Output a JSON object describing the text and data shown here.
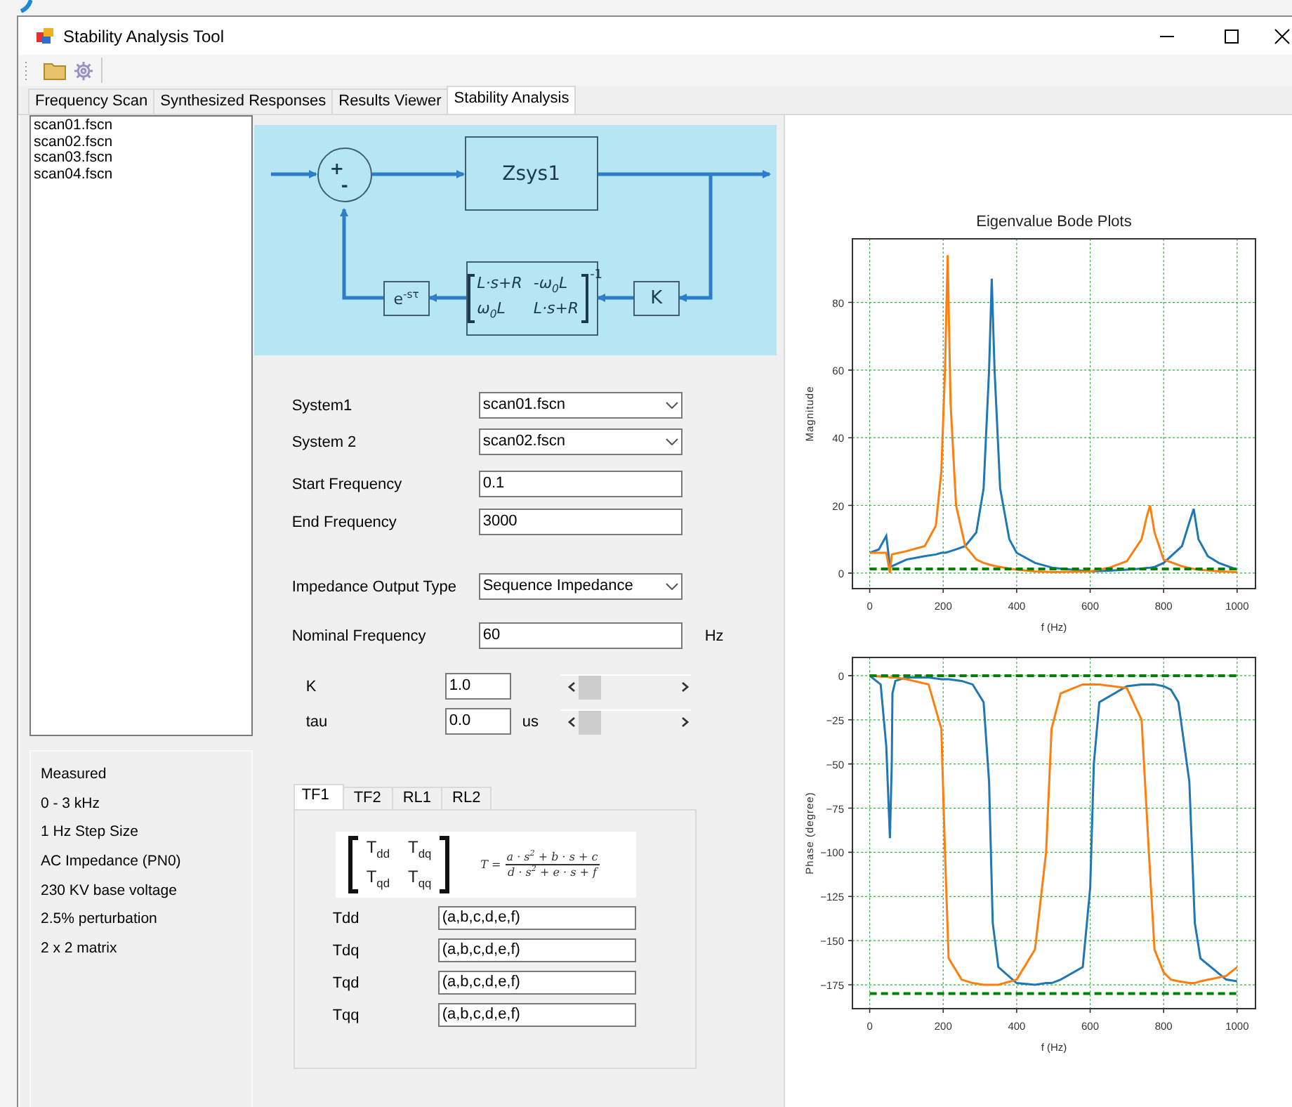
{
  "window": {
    "title": "Stability Analysis Tool"
  },
  "tabs": [
    {
      "label": "Frequency Scan",
      "selected": false
    },
    {
      "label": "Synthesized Responses",
      "selected": false
    },
    {
      "label": "Results Viewer",
      "selected": false
    },
    {
      "label": "Stability Analysis",
      "selected": true
    }
  ],
  "files": [
    "scan01.fscn",
    "scan02.fscn",
    "scan03.fscn",
    "scan04.fscn"
  ],
  "info": [
    "Measured",
    "0 - 3 kHz",
    "1 Hz Step Size",
    "AC Impedance (PN0)",
    "230 KV base voltage",
    "2.5% perturbation",
    "2 x 2 matrix"
  ],
  "diagram": {
    "input_sign": "+",
    "feedback_sign": "-",
    "plant": "Zsys1",
    "delay": "e$^{-sτ}$",
    "matrix": [
      "L·s+R",
      "-ω$_{0}$L",
      "ω$_{0}$L",
      "L·s+R"
    ],
    "matrix_power": "-1",
    "gain": "K"
  },
  "form": [
    {
      "kind": "dropdown",
      "label": "System1",
      "value": "scan01.fscn"
    },
    {
      "kind": "dropdown",
      "label": "System 2",
      "value": "scan02.fscn"
    },
    {
      "kind": "text",
      "label": "Start Frequency",
      "value": "0.1"
    },
    {
      "kind": "text",
      "label": "End Frequency",
      "value": "3000"
    },
    {
      "kind": "dropdown",
      "label": "Impedance Output Type",
      "value": "Sequence Impedance"
    },
    {
      "kind": "text",
      "label": "Nominal Frequency",
      "value": "60",
      "unit": "Hz"
    },
    {
      "kind": "slider",
      "label": "K",
      "value": "1.0"
    },
    {
      "kind": "slider",
      "label": "tau",
      "value": "0.0",
      "unit": "us"
    }
  ],
  "tf_tabs": [
    {
      "label": "TF1",
      "selected": true
    },
    {
      "label": "TF2",
      "selected": false
    },
    {
      "label": "RL1",
      "selected": false
    },
    {
      "label": "RL2",
      "selected": false
    }
  ],
  "tf_formula": {
    "matrix": [
      "T$_{dd}$",
      "T$_{dq}$",
      "T$_{qd}$",
      "T$_{qq}$"
    ],
    "lhs": "T =",
    "numerator": "a · s$^{2}$ + b · s + c",
    "denominator": "d · s$^{2}$ + e · s + f"
  },
  "tf_rows": [
    {
      "label": "Tdd",
      "value": "(a,b,c,d,e,f)"
    },
    {
      "label": "Tdq",
      "value": "(a,b,c,d,e,f)"
    },
    {
      "label": "Tqd",
      "value": "(a,b,c,d,e,f)"
    },
    {
      "label": "Tqq",
      "value": "(a,b,c,d,e,f)"
    }
  ],
  "plots": [
    {
      "chart_data": {
        "type": "line",
        "title": "Eigenvalue Bode Plots",
        "xlabel": "f (Hz)",
        "ylabel": "Magnitude",
        "x": [
          0,
          25,
          45,
          55,
          60,
          100,
          150,
          180,
          195,
          205,
          212,
          220,
          235,
          260,
          290,
          310,
          325,
          332,
          340,
          355,
          380,
          400,
          450,
          500,
          600,
          650,
          700,
          740,
          755,
          763,
          775,
          800,
          850,
          870,
          882,
          895,
          920,
          950,
          1000
        ],
        "series": [
          {
            "color": "#1f77b4",
            "values": [
              6,
              7,
              11,
              2,
              2,
              4,
              5,
              5.5,
              6,
              6,
              6.2,
              6.5,
              7,
              8,
              12,
              25,
              60,
              87,
              60,
              25,
              10,
              6,
              3,
              1.5,
              0.5,
              0.7,
              1,
              1.3,
              1.5,
              1.6,
              1.8,
              3,
              8,
              15,
              19,
              10,
              5,
              3,
              1
            ]
          },
          {
            "color": "#ff7f0e",
            "values": [
              6,
              6,
              6,
              0,
              5.5,
              6.5,
              8,
              14,
              30,
              60,
              94,
              50,
              20,
              8,
              4,
              3,
              2.5,
              2.3,
              2.1,
              1.8,
              1.3,
              1,
              0.5,
              0.3,
              0.5,
              1.5,
              3.5,
              10,
              17,
              20,
              12,
              4,
              2,
              1.5,
              1.2,
              1,
              0.8,
              0.5,
              0.3
            ]
          },
          {
            "color": "#008000",
            "line_style": "dashed",
            "values": [
              1.2,
              1.2,
              1.2,
              1.2,
              1.2,
              1.2,
              1.2,
              1.2,
              1.2,
              1.2,
              1.2,
              1.2,
              1.2,
              1.2,
              1.2,
              1.2,
              1.2,
              1.2,
              1.2,
              1.2,
              1.2,
              1.2,
              1.2,
              1.2,
              1.2,
              1.2,
              1.2,
              1.2,
              1.2,
              1.2,
              1.2,
              1.2,
              1.2,
              1.2,
              1.2,
              1.2,
              1.2,
              1.2,
              1.2
            ]
          }
        ],
        "grid": true,
        "xlim": [
          -47,
          1050
        ],
        "ylim": [
          -4.6,
          98.8
        ],
        "xticks": [
          0,
          200,
          400,
          600,
          800,
          1000
        ],
        "yticks": [
          0,
          20,
          40,
          60,
          80
        ]
      }
    },
    {
      "chart_data": {
        "type": "line",
        "xlabel": "f (Hz)",
        "ylabel": "Phase (degree)",
        "x": [
          0,
          30,
          45,
          55,
          60,
          62,
          70,
          100,
          160,
          195,
          205,
          215,
          250,
          280,
          310,
          325,
          335,
          350,
          400,
          450,
          480,
          495,
          520,
          580,
          600,
          610,
          625,
          700,
          740,
          760,
          775,
          800,
          820,
          840,
          870,
          885,
          900,
          970,
          1000
        ],
        "series": [
          {
            "color": "#1f77b4",
            "values": [
              0,
              -5,
              -40,
              -92,
              -50,
              -10,
              -3,
              -1,
              -1,
              -2,
              -2,
              -2,
              -3,
              -5,
              -15,
              -60,
              -140,
              -165,
              -174,
              -175,
              -174,
              -174,
              -172,
              -165,
              -120,
              -50,
              -15,
              -6,
              -5,
              -5,
              -5,
              -6,
              -8,
              -15,
              -60,
              -140,
              -160,
              -172,
              -173
            ]
          },
          {
            "color": "#ff7f0e",
            "values": [
              0,
              -0.5,
              -0.5,
              -1,
              -1,
              -1,
              -1,
              -2,
              -5,
              -30,
              -100,
              -160,
              -172,
              -174,
              -175,
              -175,
              -175,
              -175,
              -172,
              -155,
              -100,
              -30,
              -10,
              -5,
              -5,
              -5,
              -5,
              -7,
              -25,
              -100,
              -155,
              -168,
              -172,
              -173,
              -174,
              -174,
              -173,
              -170,
              -165
            ]
          },
          {
            "color": "#008000",
            "line_style": "dashed",
            "values": [
              0,
              0,
              0,
              0,
              0,
              0,
              0,
              0,
              0,
              0,
              0,
              0,
              0,
              0,
              0,
              0,
              0,
              0,
              0,
              0,
              0,
              0,
              0,
              0,
              0,
              0,
              0,
              0,
              0,
              0,
              0,
              0,
              0,
              0,
              0,
              0,
              0,
              0,
              0
            ]
          },
          {
            "color": "#008000",
            "line_style": "dashed",
            "values": [
              -180,
              -180,
              -180,
              -180,
              -180,
              -180,
              -180,
              -180,
              -180,
              -180,
              -180,
              -180,
              -180,
              -180,
              -180,
              -180,
              -180,
              -180,
              -180,
              -180,
              -180,
              -180,
              -180,
              -180,
              -180,
              -180,
              -180,
              -180,
              -180,
              -180,
              -180,
              -180,
              -180,
              -180,
              -180,
              -180,
              -180,
              -180,
              -180
            ]
          }
        ],
        "grid": true,
        "xlim": [
          -47,
          1050
        ],
        "ylim": [
          -188.5,
          10.3
        ],
        "xticks": [
          0,
          200,
          400,
          600,
          800,
          1000
        ],
        "yticks": [
          0,
          -25,
          -50,
          -75,
          -100,
          -125,
          -150,
          -175
        ]
      }
    }
  ]
}
